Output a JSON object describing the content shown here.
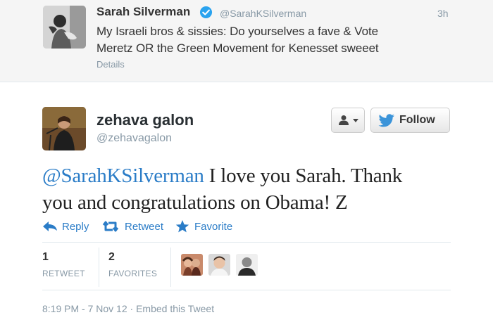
{
  "parent_tweet": {
    "name": "Sarah Silverman",
    "handle": "@SarahKSilverman",
    "time": "3h",
    "text_line_1": "My Israeli bros & sissies: Do yourselves a fave & Vote",
    "text_line_2": "Meretz OR the Green Movement for Kenesset sweeet",
    "details_link": "Details"
  },
  "tweet": {
    "name": "zehava galon",
    "handle": "@zehavagalon",
    "mention": "@SarahKSilverman",
    "text_line_1_rest": " I love you Sarah. Thank",
    "text_line_2": "you and congratulations on Obama! Z",
    "follow_label": "Follow",
    "actions": {
      "reply": "Reply",
      "retweet": "Retweet",
      "favorite": "Favorite"
    },
    "stats": {
      "retweets_count": "1",
      "retweets_label": "RETWEET",
      "favorites_count": "2",
      "favorites_label": "FAVORITES"
    },
    "timestamp": "8:19 PM - 7 Nov 12",
    "embed_link": "Embed this Tweet",
    "timestamp_separator": " · "
  },
  "colors": {
    "link": "#2a7cc7",
    "muted": "#8899a6",
    "verified": "#2aa3ef",
    "twitter_bird": "#3b94d9"
  },
  "icons": {
    "verified": "verified-badge-icon",
    "user_dropdown": "user-icon",
    "follow": "twitter-bird-icon",
    "reply": "reply-arrow-icon",
    "retweet": "retweet-icon",
    "favorite": "star-icon"
  }
}
